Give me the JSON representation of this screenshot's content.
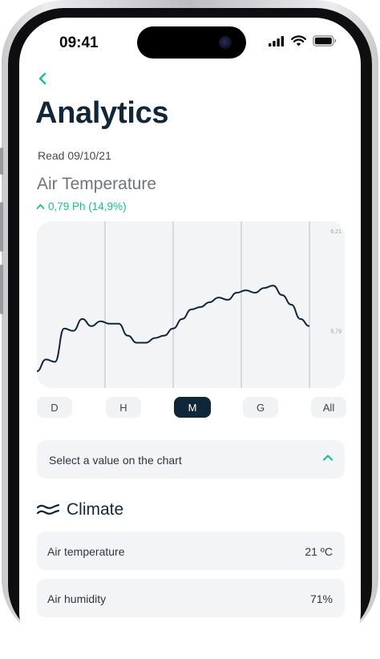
{
  "status_bar": {
    "time": "09:41"
  },
  "header": {
    "title": "Analytics",
    "read_date": "Read 09/10/21"
  },
  "metric": {
    "name": "Air Temperature",
    "change": "0,79 Ph (14,9%)"
  },
  "chart_data": {
    "type": "line",
    "ytick_labels": [
      "6,21",
      "5,79"
    ],
    "series": [
      {
        "values": [
          5.62,
          5.67,
          5.66,
          5.8,
          5.79,
          5.84,
          5.81,
          5.83,
          5.82,
          5.82,
          5.77,
          5.74,
          5.74,
          5.76,
          5.77,
          5.8,
          5.84,
          5.88,
          5.89,
          5.91,
          5.93,
          5.92,
          5.95,
          5.96,
          5.95,
          5.97,
          5.98,
          5.94,
          5.9,
          5.84,
          5.81
        ]
      }
    ],
    "ylim": [
      5.55,
      6.25
    ],
    "grid": "vertical"
  },
  "periods": [
    "D",
    "H",
    "M",
    "G",
    "All"
  ],
  "selected_period": "M",
  "select_prompt": "Select a value on the chart",
  "climate": {
    "title": "Climate",
    "rows": [
      {
        "label": "Air temperature",
        "value": "21 ºC"
      },
      {
        "label": "Air humidity",
        "value": "71%"
      }
    ]
  },
  "colors": {
    "accent": "#13c28c",
    "navy": "#10273a",
    "card": "#f3f4f6"
  }
}
